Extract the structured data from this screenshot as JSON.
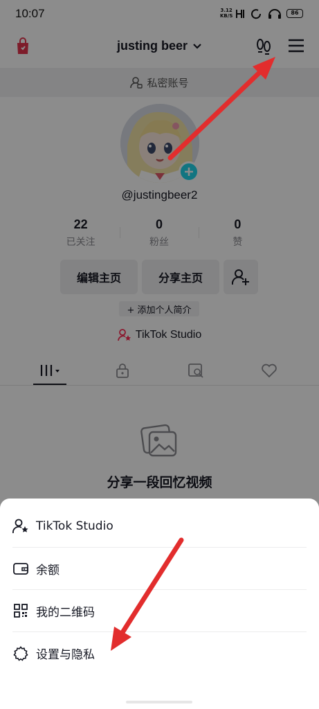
{
  "status_bar": {
    "time": "10:07",
    "net_speed_value": "3.12",
    "net_speed_unit": "KB/S",
    "battery": "86"
  },
  "header": {
    "username": "justing beer",
    "shop_icon": "shopping-bag-icon",
    "footprint_icon": "footprint-icon",
    "menu_icon": "menu-icon"
  },
  "privacy": {
    "label": "私密账号"
  },
  "profile": {
    "handle": "@justingbeer2",
    "stats": [
      {
        "value": "22",
        "label": "已关注"
      },
      {
        "value": "0",
        "label": "粉丝"
      },
      {
        "value": "0",
        "label": "赞"
      }
    ],
    "edit_button": "编辑主页",
    "share_button": "分享主页",
    "bio_button": "+ 添加个人简介",
    "studio_link": "TikTok Studio"
  },
  "tabs": [
    {
      "icon": "grid-icon",
      "active": true
    },
    {
      "icon": "lock-icon",
      "active": false
    },
    {
      "icon": "tagged-icon",
      "active": false
    },
    {
      "icon": "heart-icon",
      "active": false
    }
  ],
  "empty_state": {
    "title": "分享一段回忆视频",
    "icon": "photo-icon"
  },
  "sheet": {
    "items": [
      {
        "label": "TikTok Studio",
        "icon": "creator-icon"
      },
      {
        "label": "余额",
        "icon": "wallet-icon"
      },
      {
        "label": "我的二维码",
        "icon": "qr-code-icon"
      },
      {
        "label": "设置与隐私",
        "icon": "settings-icon"
      }
    ]
  },
  "colors": {
    "accent": "#20d5ec",
    "arrow": "#e22d2d",
    "studio_pink": "#fe2c55"
  }
}
